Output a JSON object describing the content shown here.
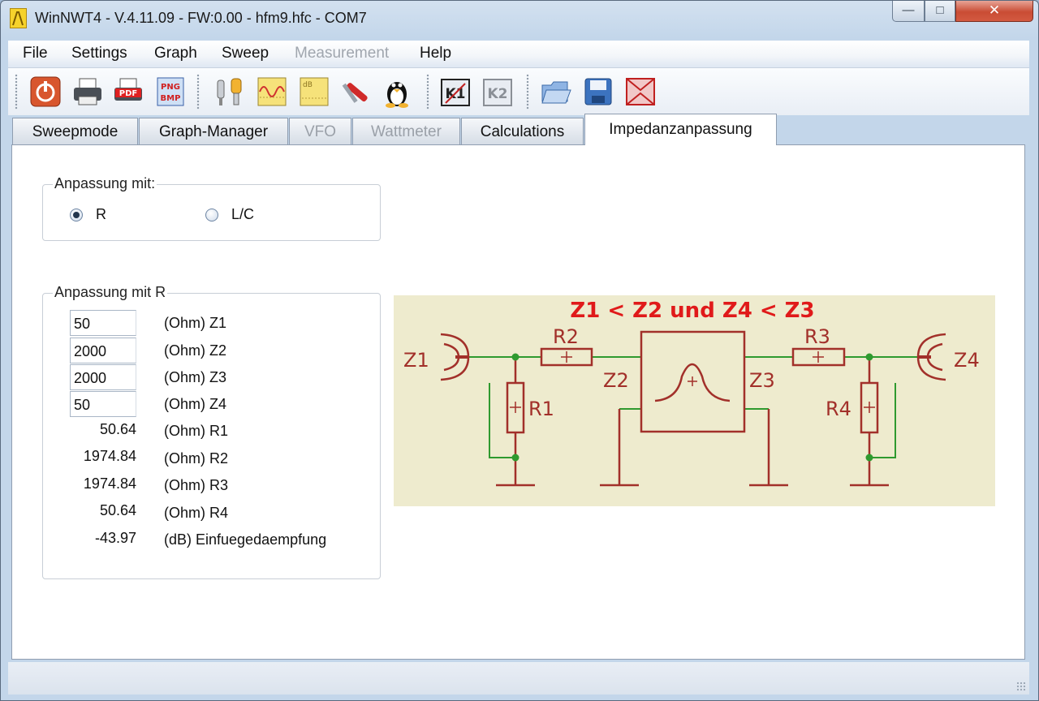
{
  "window": {
    "title": "WinNWT4 - V.4.11.09 - FW:0.00 - hfm9.hfc - COM7"
  },
  "menu": [
    {
      "label": "File",
      "enabled": true
    },
    {
      "label": "Settings",
      "enabled": true
    },
    {
      "label": "Graph",
      "enabled": true
    },
    {
      "label": "Sweep",
      "enabled": true
    },
    {
      "label": "Measurement",
      "enabled": false
    },
    {
      "label": "Help",
      "enabled": true
    }
  ],
  "toolbar": {
    "icons": [
      "power-icon",
      "printer-icon",
      "pdf-icon",
      "png-bmp-icon",
      "probe-icon",
      "graph-icon",
      "db-icon",
      "tools-icon",
      "linux-icon",
      "k1-icon",
      "k2-icon",
      "open-folder-icon",
      "save-icon",
      "frame-icon"
    ],
    "labels": {
      "pdf": "PDF",
      "png": "PNG",
      "bmp": "BMP",
      "db": "dB",
      "k1": "K1",
      "k2": "K2"
    }
  },
  "tabs": [
    {
      "label": "Sweepmode",
      "enabled": true,
      "active": false
    },
    {
      "label": "Graph-Manager",
      "enabled": true,
      "active": false
    },
    {
      "label": "VFO",
      "enabled": false,
      "active": false
    },
    {
      "label": "Wattmeter",
      "enabled": false,
      "active": false
    },
    {
      "label": "Calculations",
      "enabled": true,
      "active": false
    },
    {
      "label": "Impedanzanpassung",
      "enabled": true,
      "active": true
    }
  ],
  "matching": {
    "group_title": "Anpassung mit:",
    "options": [
      {
        "label": "R",
        "checked": true
      },
      {
        "label": "L/C",
        "checked": false
      }
    ]
  },
  "r_matching": {
    "group_title": "Anpassung mit R",
    "inputs": [
      {
        "value": "50",
        "unit": "(Ohm) Z1"
      },
      {
        "value": "2000",
        "unit": "(Ohm) Z2"
      },
      {
        "value": "2000",
        "unit": "(Ohm) Z3"
      },
      {
        "value": "50",
        "unit": "(Ohm) Z4"
      }
    ],
    "results": [
      {
        "value": "50.64",
        "unit": "(Ohm) R1"
      },
      {
        "value": "1974.84",
        "unit": "(Ohm) R2"
      },
      {
        "value": "1974.84",
        "unit": "(Ohm) R3"
      },
      {
        "value": "50.64",
        "unit": "(Ohm) R4"
      },
      {
        "value": "-43.97",
        "unit": "(dB) Einfuegedaempfung"
      }
    ]
  },
  "schematic": {
    "heading": "Z1 < Z2 und Z4 < Z3",
    "labels": {
      "z1": "Z1",
      "z2": "Z2",
      "z3": "Z3",
      "z4": "Z4",
      "r1": "R1",
      "r2": "R2",
      "r3": "R3",
      "r4": "R4"
    },
    "colors": {
      "background": "#eeebce",
      "wire": "#2f9a2f",
      "component": "#a2302a",
      "heading": "#e01a1a"
    }
  }
}
